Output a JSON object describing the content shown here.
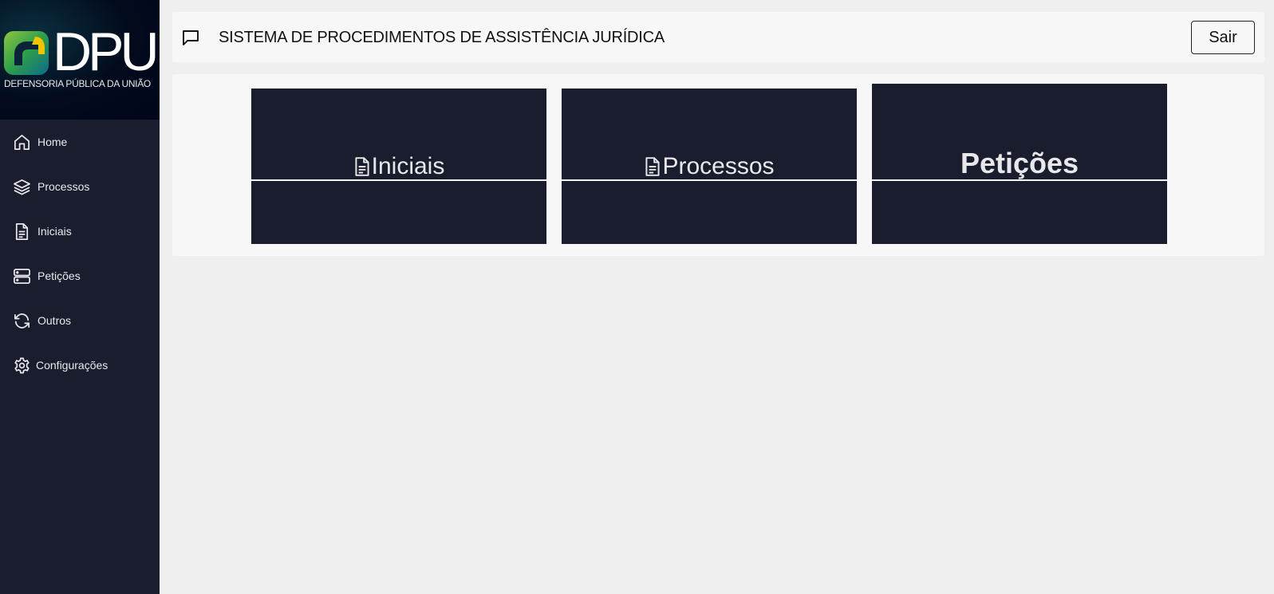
{
  "brand": {
    "wordmark": "DPU",
    "subtitle": "DEFENSORIA PÚBLICA DA UNIÃO"
  },
  "sidebar": {
    "items": [
      {
        "label": "Home",
        "icon": "home-icon"
      },
      {
        "label": "Processos",
        "icon": "layers-icon"
      },
      {
        "label": "Iniciais",
        "icon": "document-icon"
      },
      {
        "label": "Petições",
        "icon": "server-icon"
      },
      {
        "label": "Outros",
        "icon": "refresh-icon"
      },
      {
        "label": "Configurações",
        "icon": "gear-icon"
      }
    ]
  },
  "header": {
    "title": "SISTEMA DE PROCEDIMENTOS DE ASSISTÊNCIA JURÍDICA",
    "icon": "chat-icon",
    "logout_label": "Sair"
  },
  "cards": [
    {
      "label": "Iniciais",
      "icon": "document-icon"
    },
    {
      "label": "Processos",
      "icon": "document-icon"
    },
    {
      "label": "Petições"
    }
  ],
  "colors": {
    "sidebar": "#1a1d2e",
    "card": "#1a1d2e",
    "background": "#efefef",
    "panel": "#f7f7f7"
  }
}
